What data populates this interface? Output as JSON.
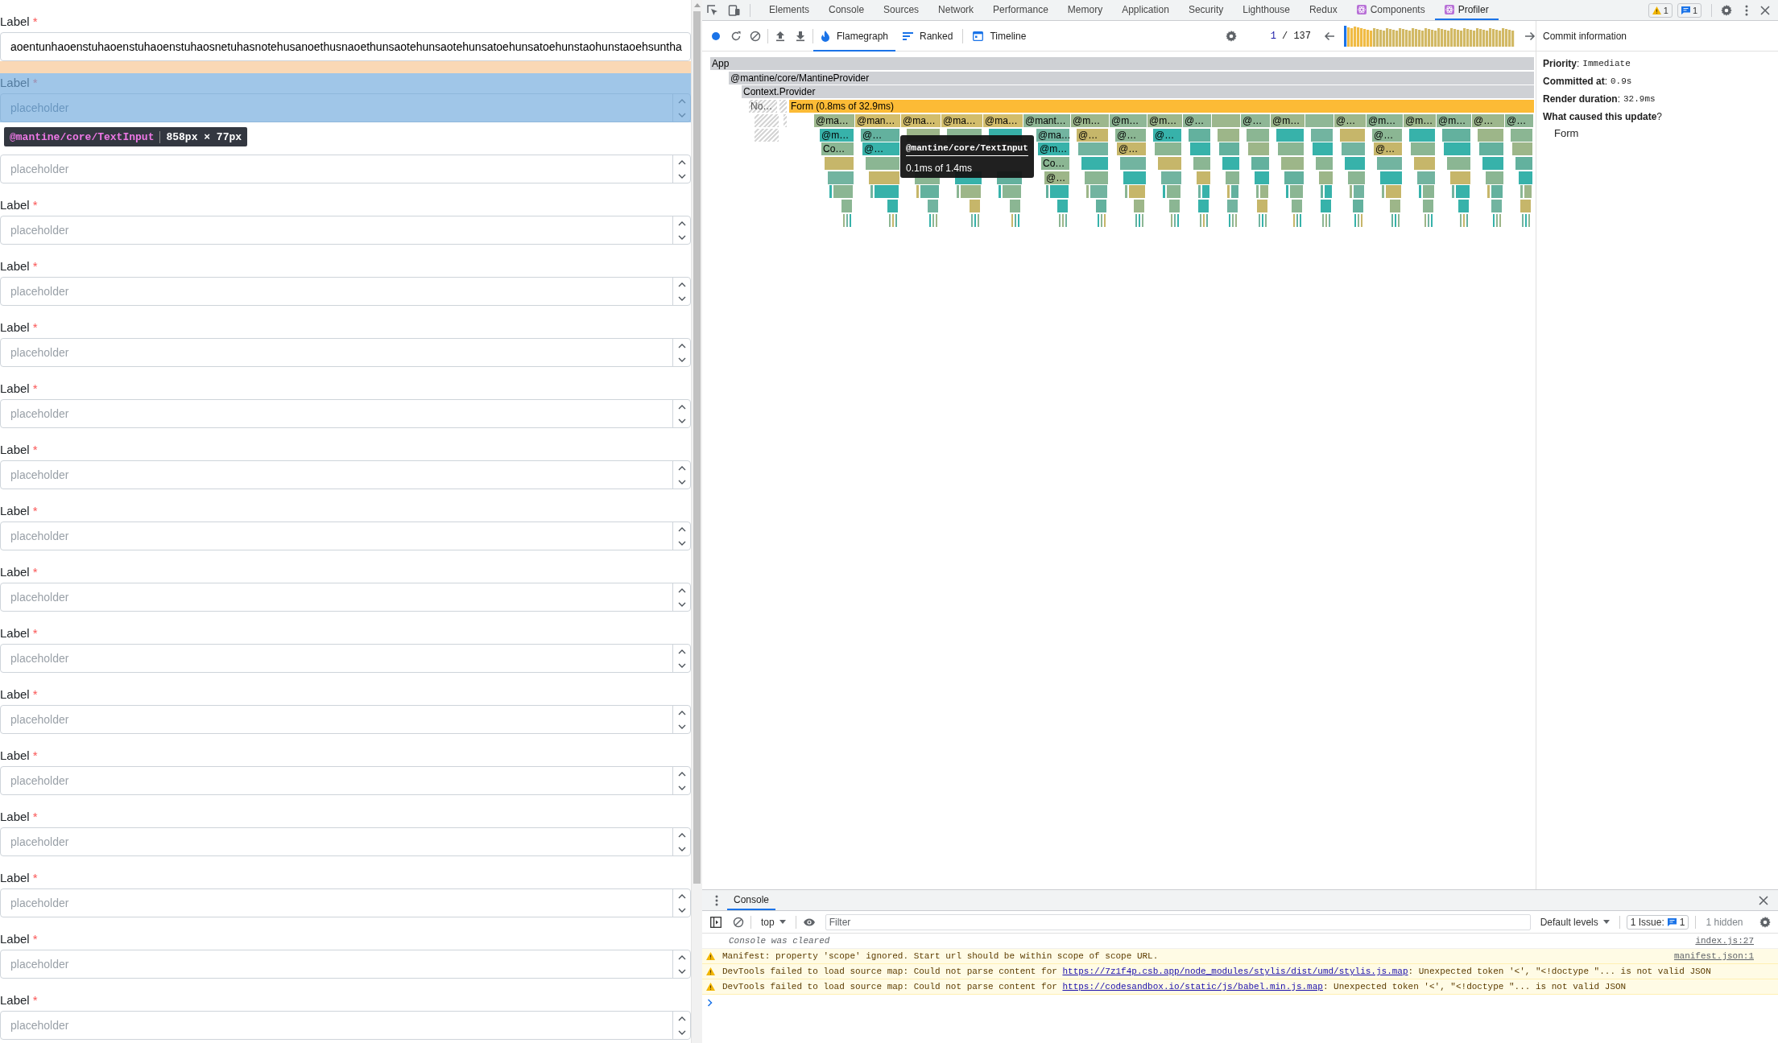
{
  "form": {
    "fields": [
      {
        "label": "Label",
        "asterisk": "*",
        "value": "aoentunhaoenstuhaoenstuhaoenstuhaosnetuhasnotehusanoethusnaoethunsaotehunsaotehunsatoehunsatoehunstaohunstaoehsuntha",
        "spinner": false,
        "highlighted": false
      },
      {
        "label": "Label",
        "asterisk": "*",
        "placeholder": "placeholder",
        "spinner": true,
        "highlighted": true
      },
      {
        "placeholder": "placeholder",
        "spinner": true,
        "highlighted": false
      },
      {
        "label": "Label",
        "asterisk": "*",
        "placeholder": "placeholder",
        "spinner": true,
        "highlighted": false
      },
      {
        "label": "Label",
        "asterisk": "*",
        "placeholder": "placeholder",
        "spinner": true,
        "highlighted": false
      },
      {
        "label": "Label",
        "asterisk": "*",
        "placeholder": "placeholder",
        "spinner": true,
        "highlighted": false
      },
      {
        "label": "Label",
        "asterisk": "*",
        "placeholder": "placeholder",
        "spinner": true,
        "highlighted": false
      },
      {
        "label": "Label",
        "asterisk": "*",
        "placeholder": "placeholder",
        "spinner": true,
        "highlighted": false
      },
      {
        "label": "Label",
        "asterisk": "*",
        "placeholder": "placeholder",
        "spinner": true,
        "highlighted": false
      },
      {
        "label": "Label",
        "asterisk": "*",
        "placeholder": "placeholder",
        "spinner": true,
        "highlighted": false
      },
      {
        "label": "Label",
        "asterisk": "*",
        "placeholder": "placeholder",
        "spinner": true,
        "highlighted": false
      },
      {
        "label": "Label",
        "asterisk": "*",
        "placeholder": "placeholder",
        "spinner": true,
        "highlighted": false
      },
      {
        "label": "Label",
        "asterisk": "*",
        "placeholder": "placeholder",
        "spinner": true,
        "highlighted": false
      },
      {
        "label": "Label",
        "asterisk": "*",
        "placeholder": "placeholder",
        "spinner": true,
        "highlighted": false
      },
      {
        "label": "Label",
        "asterisk": "*",
        "placeholder": "placeholder",
        "spinner": true,
        "highlighted": false
      },
      {
        "label": "Label",
        "asterisk": "*",
        "placeholder": "placeholder",
        "spinner": true,
        "highlighted": false
      },
      {
        "label": "Label",
        "asterisk": "*",
        "placeholder": "placeholder",
        "spinner": true,
        "highlighted": false
      }
    ],
    "inspect_tooltip": {
      "component": "@mantine/core/TextInput",
      "size": "858px × 77px"
    }
  },
  "devtools": {
    "tabs": [
      {
        "label": "Elements",
        "selected": false,
        "kind": "plain"
      },
      {
        "label": "Console",
        "selected": false,
        "kind": "plain"
      },
      {
        "label": "Sources",
        "selected": false,
        "kind": "plain"
      },
      {
        "label": "Network",
        "selected": false,
        "kind": "plain"
      },
      {
        "label": "Performance",
        "selected": false,
        "kind": "plain"
      },
      {
        "label": "Memory",
        "selected": false,
        "kind": "plain"
      },
      {
        "label": "Application",
        "selected": false,
        "kind": "plain"
      },
      {
        "label": "Security",
        "selected": false,
        "kind": "plain"
      },
      {
        "label": "Lighthouse",
        "selected": false,
        "kind": "plain"
      },
      {
        "label": "Redux",
        "selected": false,
        "kind": "plain"
      },
      {
        "label": "Components",
        "selected": false,
        "kind": "react"
      },
      {
        "label": "Profiler",
        "selected": true,
        "kind": "react"
      }
    ],
    "badges": [
      {
        "kind": "warning",
        "count": "1"
      },
      {
        "kind": "message",
        "count": "1"
      }
    ],
    "profiler": {
      "modes": [
        {
          "label": "Flamegraph",
          "selected": true,
          "kind": "flamegraph"
        },
        {
          "label": "Ranked",
          "selected": false,
          "kind": "ranked"
        },
        {
          "label": "Timeline",
          "selected": false,
          "kind": "timeline"
        }
      ],
      "counter": {
        "current": "1",
        "rest": "/ 137"
      },
      "flamegraph": {
        "levels": [
          [
            {
              "label": "App",
              "kind": "plain"
            }
          ],
          [
            {
              "label": "@mantine/core/MantineProvider",
              "kind": "plain"
            }
          ],
          [
            {
              "label": "Context.Provider",
              "kind": "plain"
            }
          ],
          [
            {
              "label": "No…",
              "kind": "dimmed"
            },
            {
              "kind": "hatched"
            },
            {
              "label": "Form (0.8ms of 32.9ms)",
              "kind": "selected"
            }
          ]
        ],
        "stacks": [
          {
            "kind": "subtree",
            "labels": [
              "@ma…",
              "@m…",
              "Co…"
            ]
          },
          {
            "kind": "subtree",
            "labels": [
              "@man…",
              "@…",
              "@…"
            ]
          },
          {
            "kind": "subtree",
            "labels": [
              "@ma…"
            ]
          },
          {
            "kind": "subtree",
            "labels": [
              "@ma…"
            ]
          },
          {
            "kind": "subtree",
            "labels": [
              "@ma…"
            ]
          },
          {
            "kind": "subtree",
            "labels": [
              "@mant…",
              "@ma…",
              "@m…",
              "Co…",
              "@…"
            ]
          },
          {
            "kind": "subtree",
            "labels": [
              "@m…",
              "@…"
            ]
          },
          {
            "kind": "subtree",
            "labels": [
              "@m…",
              "@…",
              "@…"
            ]
          },
          {
            "kind": "subtree",
            "labels": [
              "@m…",
              "@…"
            ]
          },
          {
            "kind": "subtree",
            "labels": [
              "@…"
            ]
          },
          {
            "kind": "subtree"
          },
          {
            "kind": "subtree",
            "labels": [
              "@…"
            ]
          },
          {
            "kind": "subtree",
            "labels": [
              "@m…"
            ]
          },
          {
            "kind": "subtree"
          },
          {
            "kind": "subtree",
            "labels": [
              "@…"
            ]
          },
          {
            "kind": "subtree",
            "labels": [
              "@m…",
              "@…",
              "@…"
            ]
          },
          {
            "kind": "subtree",
            "labels": [
              "@m…"
            ]
          },
          {
            "kind": "subtree",
            "labels": [
              "@m…"
            ]
          },
          {
            "kind": "subtree",
            "labels": [
              "@…"
            ]
          },
          {
            "kind": "subtree",
            "labels": [
              "@…"
            ]
          }
        ],
        "tooltip": {
          "title": "@mantine/core/TextInput",
          "detail": "0.1ms of 1.4ms"
        }
      },
      "commit_info": {
        "title": "Commit information",
        "details": [
          {
            "label": "**Priority**:",
            "value": "Immediate"
          },
          {
            "label": "**Committed at**:",
            "value": "0.9s"
          },
          {
            "label": "**Render duration**:",
            "value": "32.9ms"
          }
        ],
        "cause_heading": "**What caused this update**?",
        "causes": [
          "Form"
        ]
      }
    },
    "drawer": {
      "tab": "Console",
      "context": "top",
      "filter": {
        "placeholder": "Filter"
      },
      "levels": "Default levels",
      "issues": {
        "label": "1 Issue:",
        "count": "1"
      },
      "hidden": "1 hidden",
      "messages": [
        {
          "kind": "info",
          "text": "Console was cleared",
          "source": "index.js:27"
        },
        {
          "kind": "warning",
          "text": "Manifest: property 'scope' ignored. Start url should be within scope of scope URL.",
          "source": "manifest.json:1"
        },
        {
          "kind": "warning",
          "text": "DevTools failed to load source map: Could not parse content for ",
          "link": "https://7z1f4p.csb.app/node_modules/stylis/dist/umd/stylis.js.map",
          "after": ": Unexpected token '<', \"<!doctype \"... is not valid JSON"
        },
        {
          "kind": "warning",
          "text": "DevTools failed to load source map: Could not parse content for ",
          "link": "https://codesandbox.io/static/js/babel.min.js.map",
          "after": ": Unexpected token '<', \"<!doctype \"... is not valid JSON"
        }
      ]
    }
  }
}
